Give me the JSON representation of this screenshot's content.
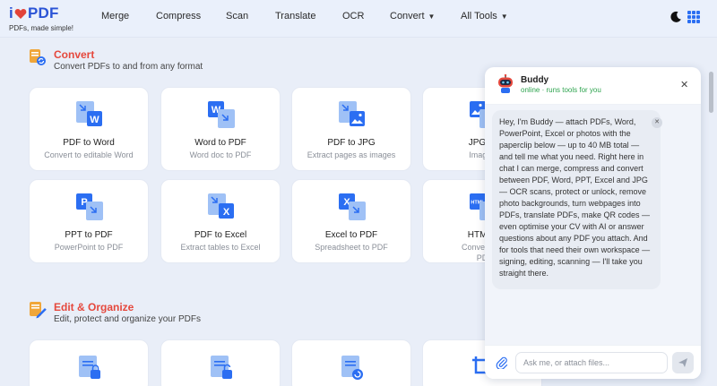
{
  "brand": {
    "logo_prefix": "i",
    "logo_suffix": "PDF",
    "tagline": "PDFs, made simple!"
  },
  "nav": {
    "items": [
      "Merge",
      "Compress",
      "Scan",
      "Translate",
      "OCR"
    ],
    "convert": "Convert",
    "all_tools": "All Tools"
  },
  "sections": {
    "convert": {
      "title": "Convert",
      "subtitle": "Convert PDFs to and from any format"
    },
    "edit": {
      "title": "Edit & Organize",
      "subtitle": "Edit, protect and organize your PDFs"
    }
  },
  "convert_cards": [
    {
      "title": "PDF to Word",
      "sub": "Convert to editable Word",
      "badge": "W",
      "badge_color": "#2b6ef2"
    },
    {
      "title": "Word to PDF",
      "sub": "Word doc to PDF",
      "badge": "W",
      "badge_color": "#2b6ef2"
    },
    {
      "title": "PDF to JPG",
      "sub": "Extract pages as images",
      "badge": "image-icon",
      "badge_color": "#2b6ef2"
    },
    {
      "title": "JPG to",
      "sub": "Images",
      "badge": "image-icon",
      "badge_color": "#2b6ef2"
    },
    {
      "title": "PPT to PDF",
      "sub": "PowerPoint to PDF",
      "badge": "P",
      "badge_color": "#2b6ef2"
    },
    {
      "title": "PDF to Excel",
      "sub": "Extract tables to Excel",
      "badge": "X",
      "badge_color": "#2b6ef2"
    },
    {
      "title": "Excel to PDF",
      "sub": "Spreadsheet to PDF",
      "badge": "X",
      "badge_color": "#2b6ef2"
    },
    {
      "title": "HTML t",
      "sub": "Convert HT",
      "sub2": "PD",
      "badge": "HTML",
      "badge_color": "#2b6ef2"
    }
  ],
  "chat": {
    "name": "Buddy",
    "status": "online · runs tools for you",
    "message": "Hey, I'm Buddy — attach PDFs, Word, PowerPoint, Excel or photos with the paperclip below — up to 40 MB total — and tell me what you need. Right here in chat I can merge, compress and convert between PDF, Word, PPT, Excel and JPG — OCR scans, protect or unlock, remove photo backgrounds, turn webpages into PDFs, translate PDFs, make QR codes — even optimise your CV with AI or answer questions about any PDF you attach. And for tools that need their own workspace — signing, editing, scanning — I'll take you straight there.",
    "input_placeholder": "Ask me, or attach files..."
  },
  "colors": {
    "accent": "#2b6ef2",
    "brand_red": "#e5483d",
    "online": "#2ea44f"
  }
}
